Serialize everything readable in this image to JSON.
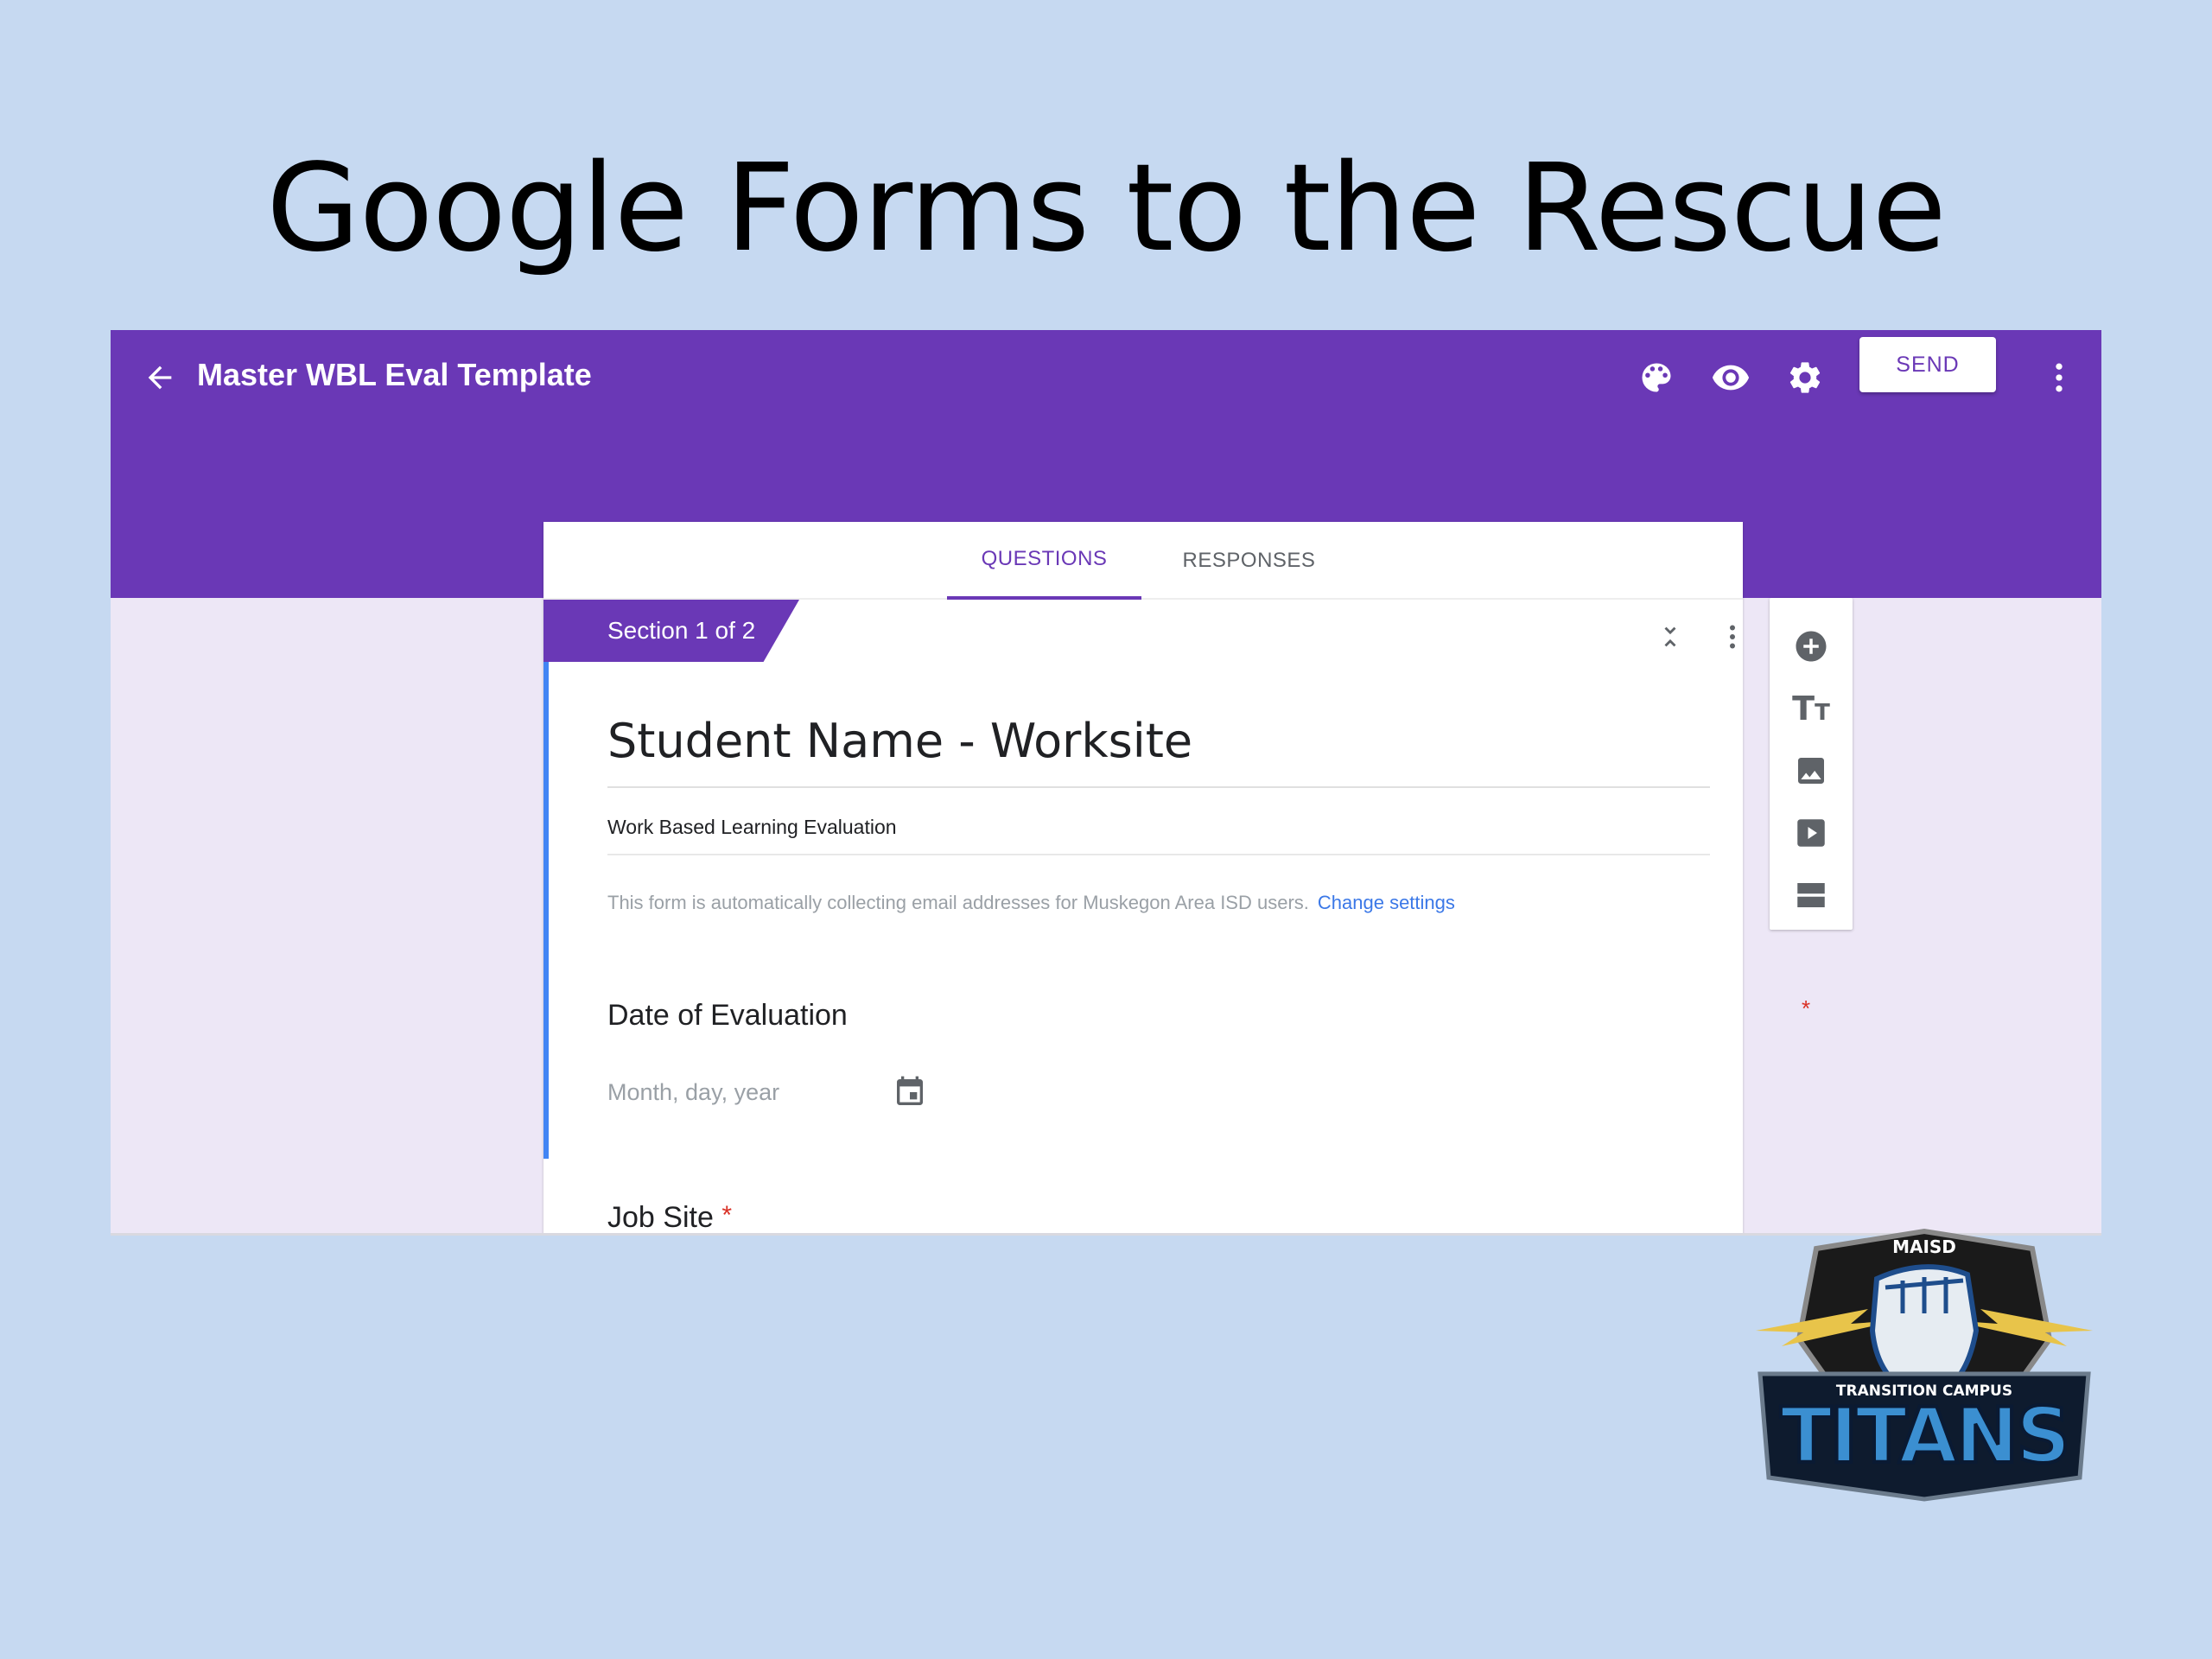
{
  "slide": {
    "title": "Google Forms to the Rescue"
  },
  "header": {
    "form_name": "Master WBL Eval Template",
    "send_label": "SEND"
  },
  "tabs": [
    {
      "label": "QUESTIONS",
      "active": true
    },
    {
      "label": "RESPONSES",
      "active": false
    }
  ],
  "section": {
    "label": "Section 1 of 2"
  },
  "form": {
    "title": "Student Name - Worksite",
    "description": "Work Based Learning Evaluation",
    "email_notice": "This form is automatically collecting email addresses for Muskegon Area ISD users.",
    "change_settings_label": "Change settings"
  },
  "questions": [
    {
      "label": "Date of Evaluation",
      "required_mark": "*",
      "placeholder": "Month, day, year"
    },
    {
      "label": "Job Site",
      "required_mark": "*"
    }
  ],
  "logo": {
    "top_text": "MAISD",
    "band_text": "TRANSITION CAMPUS",
    "main_text": "TITANS"
  },
  "colors": {
    "slide_background": "#c6d9f1",
    "accent": "#6a38b6",
    "page_background": "#ede7f6",
    "link": "#3b78e7",
    "required": "#d93025",
    "section_accent": "#4285f4"
  },
  "icons": [
    "back-arrow-icon",
    "palette-icon",
    "eye-icon",
    "gear-icon",
    "more-vert-icon",
    "collapse-icon",
    "add-circle-icon",
    "title-icon",
    "image-icon",
    "video-icon",
    "section-icon",
    "calendar-icon"
  ]
}
